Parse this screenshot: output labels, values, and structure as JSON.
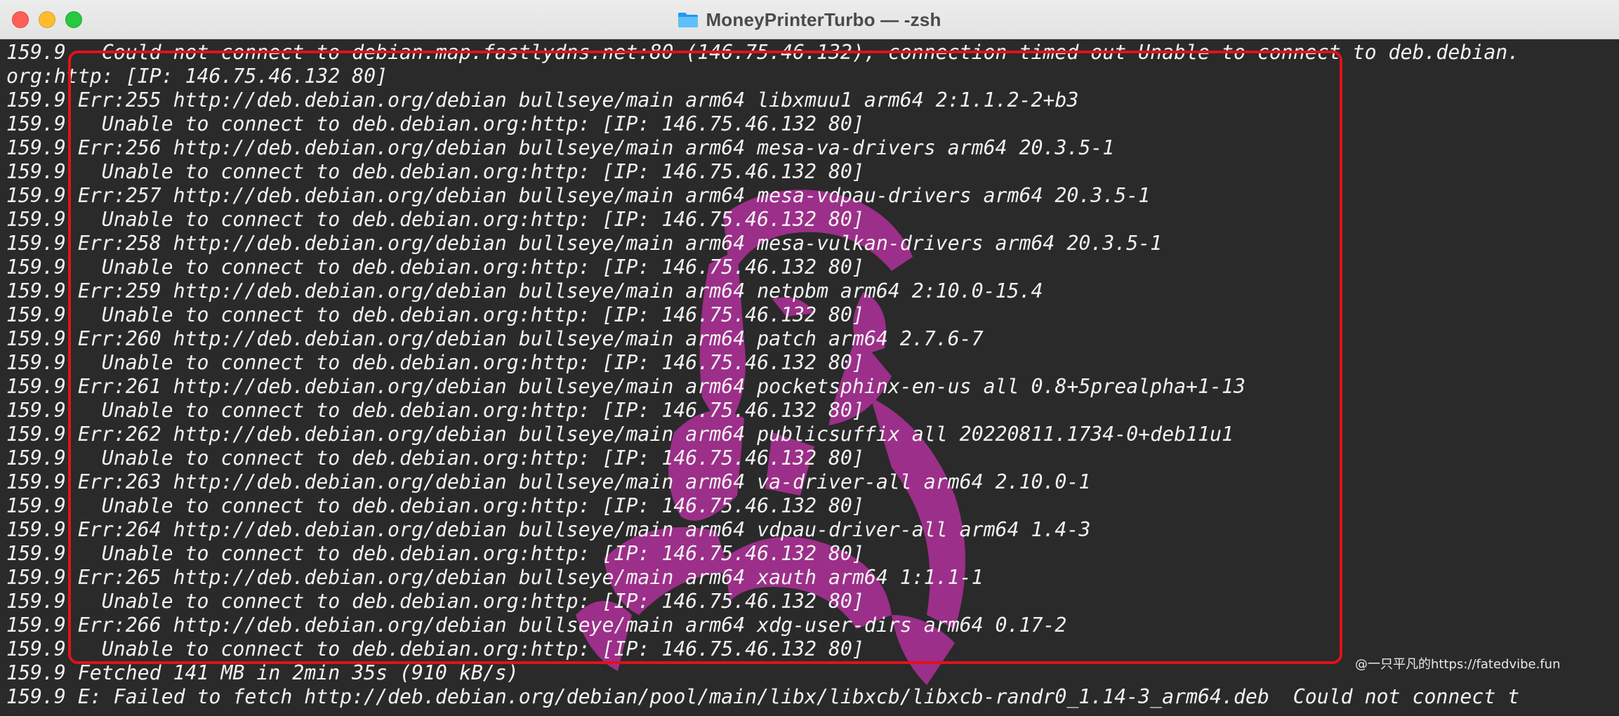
{
  "window": {
    "title": "MoneyPrinterTurbo — -zsh",
    "title_icon": "folder-icon"
  },
  "terminal": {
    "lines": [
      "159.9   Could not connect to debian.map.fastlydns.net:80 (146.75.46.132), connection timed out Unable to connect to deb.debian.",
      "org:http: [IP: 146.75.46.132 80]",
      "159.9 Err:255 http://deb.debian.org/debian bullseye/main arm64 libxmuu1 arm64 2:1.1.2-2+b3",
      "159.9   Unable to connect to deb.debian.org:http: [IP: 146.75.46.132 80]",
      "159.9 Err:256 http://deb.debian.org/debian bullseye/main arm64 mesa-va-drivers arm64 20.3.5-1",
      "159.9   Unable to connect to deb.debian.org:http: [IP: 146.75.46.132 80]",
      "159.9 Err:257 http://deb.debian.org/debian bullseye/main arm64 mesa-vdpau-drivers arm64 20.3.5-1",
      "159.9   Unable to connect to deb.debian.org:http: [IP: 146.75.46.132 80]",
      "159.9 Err:258 http://deb.debian.org/debian bullseye/main arm64 mesa-vulkan-drivers arm64 20.3.5-1",
      "159.9   Unable to connect to deb.debian.org:http: [IP: 146.75.46.132 80]",
      "159.9 Err:259 http://deb.debian.org/debian bullseye/main arm64 netpbm arm64 2:10.0-15.4",
      "159.9   Unable to connect to deb.debian.org:http: [IP: 146.75.46.132 80]",
      "159.9 Err:260 http://deb.debian.org/debian bullseye/main arm64 patch arm64 2.7.6-7",
      "159.9   Unable to connect to deb.debian.org:http: [IP: 146.75.46.132 80]",
      "159.9 Err:261 http://deb.debian.org/debian bullseye/main arm64 pocketsphinx-en-us all 0.8+5prealpha+1-13",
      "159.9   Unable to connect to deb.debian.org:http: [IP: 146.75.46.132 80]",
      "159.9 Err:262 http://deb.debian.org/debian bullseye/main arm64 publicsuffix all 20220811.1734-0+deb11u1",
      "159.9   Unable to connect to deb.debian.org:http: [IP: 146.75.46.132 80]",
      "159.9 Err:263 http://deb.debian.org/debian bullseye/main arm64 va-driver-all arm64 2.10.0-1",
      "159.9   Unable to connect to deb.debian.org:http: [IP: 146.75.46.132 80]",
      "159.9 Err:264 http://deb.debian.org/debian bullseye/main arm64 vdpau-driver-all arm64 1.4-3",
      "159.9   Unable to connect to deb.debian.org:http: [IP: 146.75.46.132 80]",
      "159.9 Err:265 http://deb.debian.org/debian bullseye/main arm64 xauth arm64 1:1.1-1",
      "159.9   Unable to connect to deb.debian.org:http: [IP: 146.75.46.132 80]",
      "159.9 Err:266 http://deb.debian.org/debian bullseye/main arm64 xdg-user-dirs arm64 0.17-2",
      "159.9   Unable to connect to deb.debian.org:http: [IP: 146.75.46.132 80]",
      "159.9 Fetched 141 MB in 2min 35s (910 kB/s)",
      "159.9 E: Failed to fetch http://deb.debian.org/debian/pool/main/libx/libxcb/libxcb-randr0_1.14-3_arm64.deb  Could not connect t"
    ]
  },
  "colors": {
    "background": "#2a2a2a",
    "text": "#f2f2f2",
    "highlight_border": "#e0121a",
    "watermark": "#b0309a"
  },
  "credit": "@一只平凡的https://fatedvibe.fun"
}
